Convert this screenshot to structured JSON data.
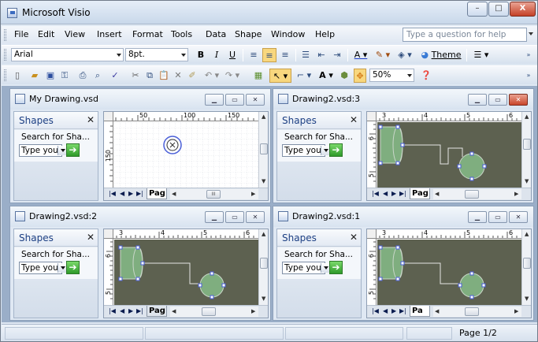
{
  "app": {
    "title": "Microsoft Visio",
    "controls": {
      "minimize": "–",
      "maximize": "□",
      "close": "X"
    }
  },
  "menu": {
    "items": [
      "File",
      "Edit",
      "View",
      "Insert",
      "Format",
      "Tools",
      "Data",
      "Shape",
      "Window",
      "Help"
    ],
    "mnemonics": [
      "F",
      "E",
      "V",
      "I",
      "o",
      "T",
      "D",
      "S",
      "W",
      "H"
    ],
    "question_placeholder": "Type a question for help"
  },
  "toolbar_format": {
    "font": "Arial",
    "size": "8pt.",
    "bold": "B",
    "italic": "I",
    "underline": "U",
    "theme": "Theme"
  },
  "toolbar_standard": {
    "zoom": "50%"
  },
  "status": {
    "page": "Page 1/2"
  },
  "windows": [
    {
      "title": "My Drawing.vsd",
      "shapes_label": "Shapes",
      "search_label": "Search for Sha...",
      "search_value": "Type you",
      "page_tab": "Pag",
      "ruler_h": [
        "50",
        "100",
        "150"
      ],
      "ruler_v": [
        "150"
      ],
      "active": false,
      "content": "grid"
    },
    {
      "title": "Drawing2.vsd:3",
      "shapes_label": "Shapes",
      "search_label": "Search for Sha...",
      "search_value": "Type you",
      "page_tab": "Pag",
      "ruler_h": [
        "3",
        "4",
        "5",
        "6"
      ],
      "ruler_v": [
        "6",
        "5"
      ],
      "active": true,
      "content": "flow"
    },
    {
      "title": "Drawing2.vsd:2",
      "shapes_label": "Shapes",
      "search_label": "Search for Sha...",
      "search_value": "Type you",
      "page_tab": "Pag",
      "ruler_h": [
        "3",
        "4",
        "5",
        "6"
      ],
      "ruler_v": [
        "6",
        "5"
      ],
      "active": false,
      "content": "flow"
    },
    {
      "title": "Drawing2.vsd:1",
      "shapes_label": "Shapes",
      "search_label": "Search for Sha...",
      "search_value": "Type you",
      "page_tab": "Pa",
      "ruler_h": [
        "3",
        "4",
        "5",
        "6"
      ],
      "ruler_v": [
        "6",
        "5"
      ],
      "active": false,
      "content": "flow"
    }
  ],
  "colors": {
    "canvas_dark": "#5d6150",
    "shape_fill": "#7fae7f",
    "handle": "#4a5fd8",
    "close_active": "#d0462c"
  }
}
